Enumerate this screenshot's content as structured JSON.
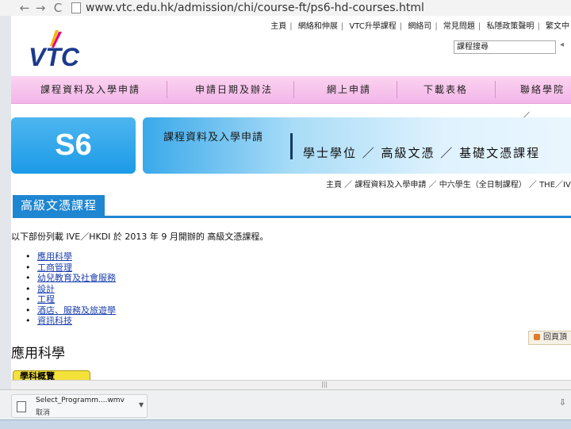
{
  "browser": {
    "url_host": "www.vtc.edu.hk",
    "url_path": "/admission/chi/course-ft/ps6-hd-courses.html",
    "back_glyph": "←",
    "forward_glyph": "→",
    "reload_glyph": "C"
  },
  "site": {
    "top_links": [
      "主頁",
      "網絡和伸展",
      "VTC升學課程",
      "網絡司",
      "常見問題",
      "私隱政策聲明",
      "繁文中"
    ],
    "search_value": "課程搜尋",
    "search_icon": "search-icon",
    "menu": [
      "課程資料及入學申請",
      "申請日期及辦法",
      "網上申請",
      "下載表格",
      "聯絡學院／"
    ],
    "banner_badge": "S6",
    "banner_title": "課程資料及入學申請",
    "banner_subtitle": "學士學位 ／ 高級文憑 ／ 基礎文憑課程",
    "breadcrumb": "主頁 ／ 課程資料及入學申請 ／ 中六學生（全日制課程） ／ THE／IVE",
    "section_title": "高級文憑課程",
    "intro": "以下部份列載 IVE／HKDI 於 2013 年 9 月開辦的 高級文憑課程。",
    "courses": [
      "應用科學",
      "工商管理",
      "幼兒教育及社會服務",
      "設計",
      "工程",
      "酒店、服務及旅遊學",
      "資訊科技"
    ],
    "subheading": "應用科學",
    "print_label": "回頁頂",
    "info_tab": "學科概覽"
  },
  "download": {
    "filename": "Select_Programm....wmv",
    "status": "取消",
    "show_all_glyph": "⇩"
  },
  "colors": {
    "menu_pink": "#f3b6e8",
    "accent_blue": "#1f86d2",
    "logo_yellow": "#f2b705",
    "logo_pink": "#e6007e",
    "logo_blue": "#1b3a8c"
  }
}
